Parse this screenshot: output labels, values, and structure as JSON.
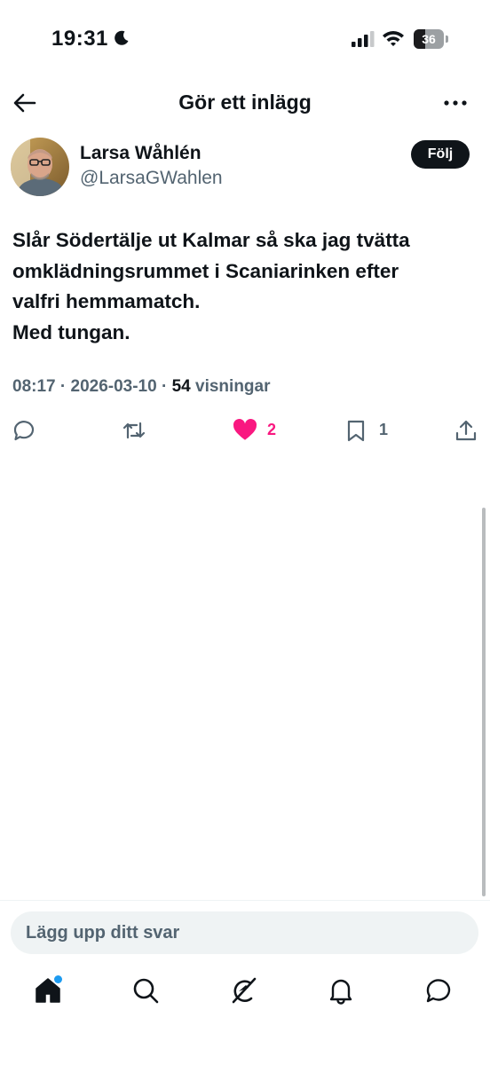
{
  "status_bar": {
    "time": "19:31",
    "battery": "36",
    "icons": [
      "moon-icon",
      "cellular-signal-icon",
      "wifi-icon",
      "battery-icon"
    ]
  },
  "header": {
    "title": "Gör ett inlägg",
    "back_icon": "arrow-left-icon",
    "more_icon": "more-horizontal-icon"
  },
  "post": {
    "author": {
      "name": "Larsa Wåhlén",
      "handle": "@LarsaGWahlen"
    },
    "follow_label": "Följ",
    "text_lines": [
      "Slår Södertälje ut Kalmar så ska jag tvätta",
      "omklädningsrummet i Scaniarinken efter",
      "valfri hemmamatch.",
      "Med tungan."
    ],
    "time": "08:17",
    "date": "2026-03-10",
    "views_count": "54",
    "views_label": "visningar",
    "separator": "·",
    "actions": {
      "reply_icon": "reply-icon",
      "retweet_icon": "retweet-icon",
      "like_icon": "heart-filled-icon",
      "likes": "2",
      "bookmark_icon": "bookmark-icon",
      "bookmarks": "1",
      "share_icon": "share-icon"
    }
  },
  "reply": {
    "placeholder": "Lägg upp ditt svar"
  },
  "tab_bar": {
    "items": [
      "home-icon",
      "search-icon",
      "grok-icon",
      "bell-icon",
      "messages-icon"
    ]
  },
  "colors": {
    "text": "#0f1419",
    "secondary": "#536471",
    "like": "#f91880",
    "accent": "#1d9bf0",
    "input_bg": "#eff3f4"
  }
}
